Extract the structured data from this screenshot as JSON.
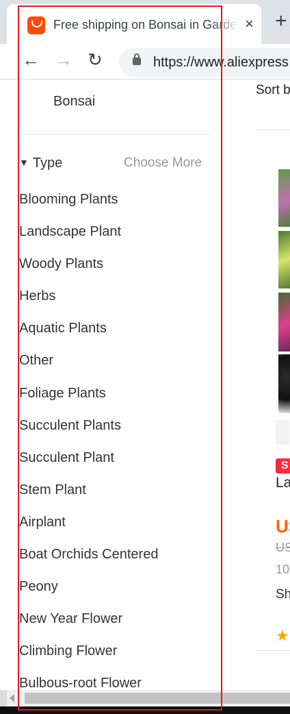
{
  "browser": {
    "tab_title": "Free shipping on Bonsai in Garden",
    "tab_close": "×",
    "new_tab": "+",
    "back": "←",
    "forward": "→",
    "reload": "↻",
    "url": "https://www.aliexpress"
  },
  "sidebar": {
    "category_title": "Bonsai",
    "filter_header": "Type",
    "filter_caret": "▼",
    "choose_more": "Choose More",
    "types": [
      "Blooming Plants",
      "Landscape Plant",
      "Woody Plants",
      "Herbs",
      "Aquatic Plants",
      "Other",
      "Foliage Plants",
      "Succulent Plants",
      "Succulent Plant",
      "Stem Plant",
      "Airplant",
      "Boat Orchids Centered",
      "Peony",
      "New Year Flower",
      "Climbing Flower",
      "Bulbous-root Flower"
    ]
  },
  "results": {
    "sort_label": "Sort b",
    "badge": "S",
    "product_name": "La",
    "price": "US",
    "old_price": "US",
    "orders": "10",
    "shipping": "Sh",
    "rating_icon": "star-icon"
  },
  "colors": {
    "highlight": "#e8161b",
    "price": "#ff6600",
    "badge": "#ff2a3f",
    "favicon": "#ff4a00"
  }
}
